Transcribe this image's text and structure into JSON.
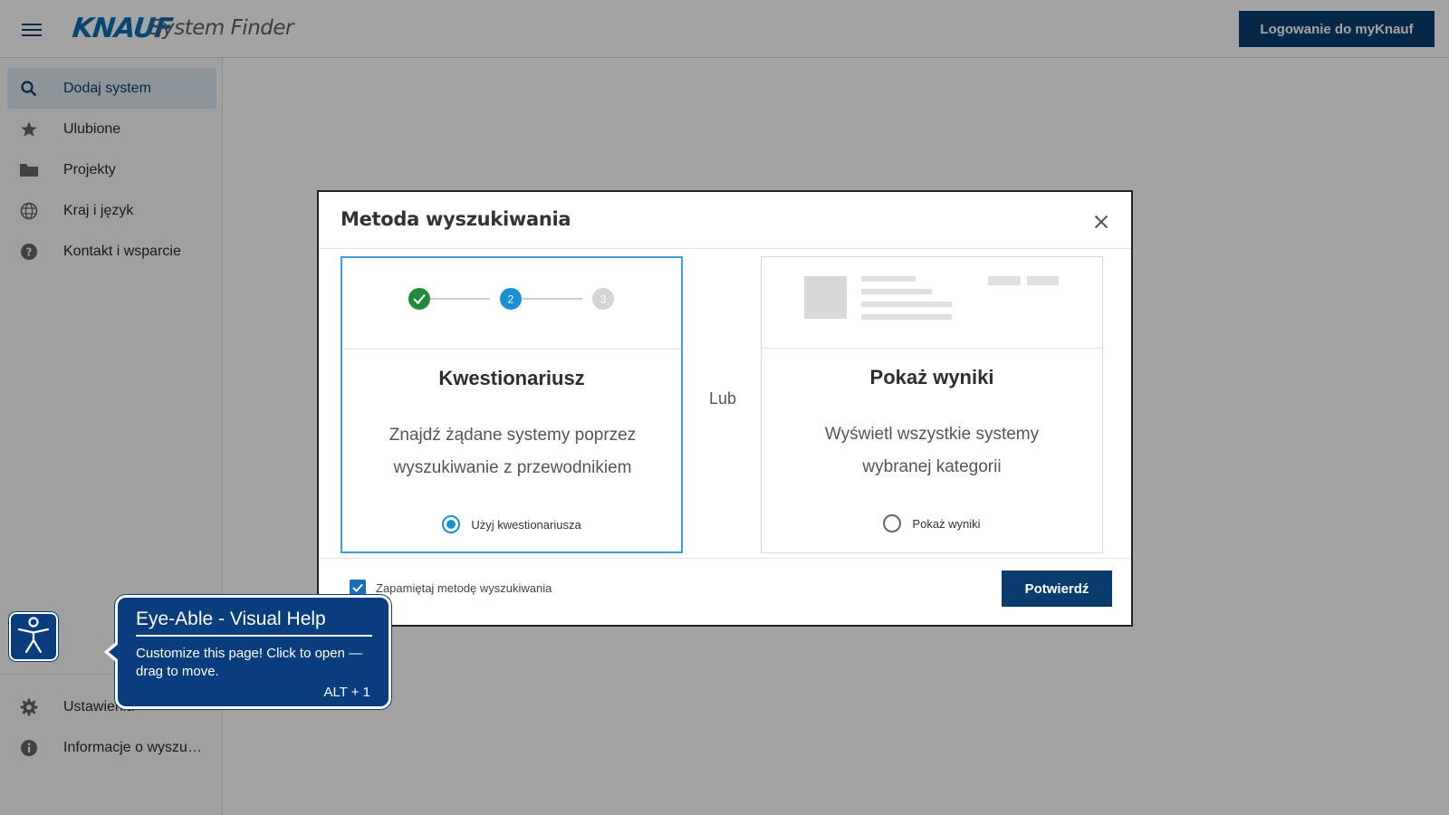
{
  "header": {
    "logo": "KNAUF",
    "app_title": "System Finder",
    "login_label": "Logowanie do myKnauf"
  },
  "sidebar": {
    "items": [
      {
        "label": "Dodaj system",
        "icon": "search-icon",
        "active": true
      },
      {
        "label": "Ulubione",
        "icon": "star-icon"
      },
      {
        "label": "Projekty",
        "icon": "folder-icon"
      },
      {
        "label": "Kraj i język",
        "icon": "globe-icon"
      },
      {
        "label": "Kontakt i wsparcie",
        "icon": "help-icon"
      }
    ],
    "bottom_items": [
      {
        "label": "Ustawienia",
        "icon": "gear-icon"
      },
      {
        "label": "Informacje o wyszuki...",
        "icon": "info-icon"
      }
    ]
  },
  "modal": {
    "title": "Metoda wyszukiwania",
    "separator": "Lub",
    "options": [
      {
        "title": "Kwestionariusz",
        "description": "Znajdź żądane systemy poprzez wyszukiwanie z przewodnikiem",
        "radio_label": "Użyj kwestionariusza",
        "selected": true,
        "steps": [
          "2",
          "3"
        ]
      },
      {
        "title": "Pokaż wyniki",
        "description": "Wyświetl wszystkie systemy wybranej kategorii",
        "radio_label": "Pokaż wyniki",
        "selected": false
      }
    ],
    "remember_label": "Zapamiętaj metodę wyszukiwania",
    "remember_checked": true,
    "confirm_label": "Potwierdź"
  },
  "eye_able": {
    "title": "Eye-Able - Visual Help",
    "text": "Customize this page! Click to open — drag to move.",
    "shortcut": "ALT + 1"
  },
  "colors": {
    "brand_dark": "#0a3d6e",
    "accent_blue": "#1a8fd6",
    "success_green": "#1e8a3a",
    "eye_able_blue": "#0a3d7e"
  }
}
